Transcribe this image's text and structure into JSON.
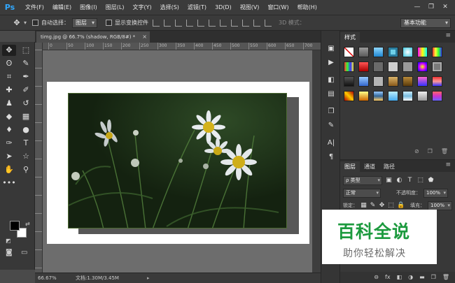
{
  "app": {
    "logo": "Ps"
  },
  "menu": [
    "文件(F)",
    "编辑(E)",
    "图像(I)",
    "图层(L)",
    "文字(Y)",
    "选择(S)",
    "滤镜(T)",
    "3D(D)",
    "视图(V)",
    "窗口(W)",
    "帮助(H)"
  ],
  "window_controls": {
    "minimize": "—",
    "restore": "❐",
    "close": "✕"
  },
  "options": {
    "auto_select_label": "自动选择：",
    "auto_select_value": "图层",
    "show_transform_label": "显示变换控件",
    "mode_3d_label": "3D 模式：",
    "workspace_value": "基本功能"
  },
  "document": {
    "tab_title": "timg.jpg @ 66.7% (shadow, RGB/8#) *",
    "tab_close": "×"
  },
  "ruler_h_labels": [
    "0",
    "50",
    "100",
    "150",
    "200",
    "250",
    "300",
    "350",
    "400",
    "450",
    "500",
    "550",
    "600",
    "650",
    "700"
  ],
  "status": {
    "zoom": "66.67%",
    "doc_size": "文档:1.30M/3.45M",
    "arrow": "▸"
  },
  "panels": {
    "styles": {
      "tab": "样式",
      "menu": "≡",
      "footer_icons": [
        "⊘",
        "❐",
        "🗑"
      ]
    },
    "layers": {
      "tabs": [
        "图层",
        "通道",
        "路径"
      ],
      "menu": "≡",
      "filter_label": "ρ 类型",
      "filter_icons": [
        "▣",
        "◐",
        "T",
        "⬚",
        "⬟"
      ],
      "blend_mode": "正常",
      "opacity_label": "不透明度：",
      "opacity_value": "100%",
      "lock_label": "锁定：",
      "fill_label": "填充：",
      "fill_value": "100%",
      "footer_icons": [
        "⊖",
        "fx",
        "◧",
        "◑",
        "▬",
        "❐",
        "🗑"
      ]
    }
  },
  "watermark": {
    "title": "百科全说",
    "subtitle": "助你轻松解决"
  },
  "tools": [
    "move-tool",
    "marquee-tool",
    "lasso-tool",
    "quick-select-tool",
    "crop-tool",
    "eyedropper-tool",
    "healing-tool",
    "brush-tool",
    "stamp-tool",
    "history-brush-tool",
    "eraser-tool",
    "gradient-tool",
    "blur-tool",
    "dodge-tool",
    "pen-tool",
    "type-tool",
    "path-select-tool",
    "shape-tool",
    "hand-tool",
    "zoom-tool"
  ],
  "colors": {
    "accent": "#31a8ff",
    "watermark_green": "#1c9a3e"
  }
}
